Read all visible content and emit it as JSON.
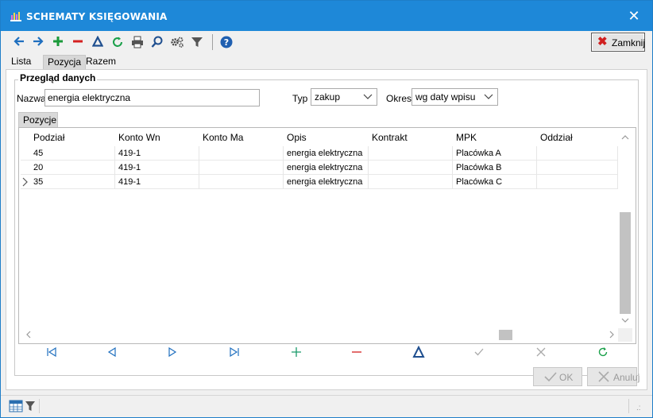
{
  "window": {
    "title": "SCHEMATY KSIĘGOWANIA",
    "close_glyph": "✕"
  },
  "toolbar": {
    "icons": [
      "arrow-left-icon",
      "arrow-right-icon",
      "plus-icon",
      "minus-icon",
      "delta-icon",
      "refresh-icon",
      "print-icon",
      "search-icon",
      "settings-icon",
      "filter-icon",
      "help-icon"
    ],
    "close_label": "Zamknij",
    "close_glyph": "✖"
  },
  "tabs": [
    {
      "label": "Lista",
      "active": false
    },
    {
      "label": "Pozycja",
      "active": true
    },
    {
      "label": "Razem",
      "active": false
    }
  ],
  "form": {
    "group_title": "Przegląd danych",
    "nazwa_label": "Nazwa",
    "nazwa_value": "energia elektryczna",
    "typ_label": "Typ",
    "typ_value": "zakup",
    "okres_label": "Okres",
    "okres_value": "wg daty wpisu"
  },
  "subtab": {
    "label": "Pozycje"
  },
  "grid": {
    "columns": [
      "Podział",
      "Konto Wn",
      "Konto Ma",
      "Opis",
      "Kontrakt",
      "MPK",
      "Oddział"
    ],
    "rows": [
      {
        "podzial": "45",
        "konto_wn": "419-1",
        "konto_ma": "",
        "opis": "energia elektryczna",
        "kontrakt": "",
        "mpk": "Placówka A",
        "oddzial": "",
        "current": false
      },
      {
        "podzial": "20",
        "konto_wn": "419-1",
        "konto_ma": "",
        "opis": "energia elektryczna",
        "kontrakt": "",
        "mpk": "Placówka B",
        "oddzial": "",
        "current": false
      },
      {
        "podzial": "35",
        "konto_wn": "419-1",
        "konto_ma": "",
        "opis": "energia elektryczna",
        "kontrakt": "",
        "mpk": "Placówka C",
        "oddzial": "",
        "current": true
      }
    ]
  },
  "navigator": {
    "icons": [
      "first-icon",
      "prior-icon",
      "next-icon",
      "last-icon",
      "insert-icon",
      "delete-icon",
      "edit-icon",
      "post-icon",
      "cancel-icon",
      "refresh-icon"
    ]
  },
  "buttons": {
    "ok_label": "OK",
    "cancel_label": "Anuluj"
  },
  "colors": {
    "titlebar": "#1e88d8",
    "toolbar_blue": "#1f6fbf",
    "add_green": "#1a9a3a",
    "delete_red": "#d42020",
    "teal": "#1a9a8a"
  }
}
